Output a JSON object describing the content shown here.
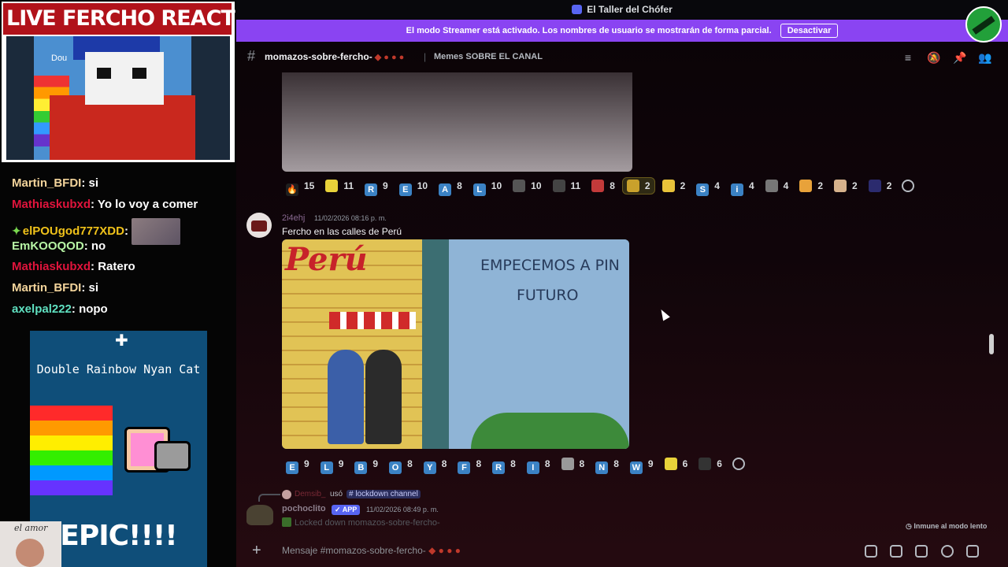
{
  "stream": {
    "title": "LIVE FERCHO REACTION",
    "cam_text": "Dou",
    "chat": [
      {
        "user": "Martin_BFDI",
        "user_color": "#f3d49b",
        "msg": ": si"
      },
      {
        "user": "Mathiaskubxd",
        "user_color": "#e0143c",
        "msg": ": Yo lo voy a comer"
      },
      {
        "user": "elPOUgod777XDD",
        "user_color": "#f0c21a",
        "msg": ":",
        "thumb": true,
        "diamond": true
      },
      {
        "user": "EmKOOQOD",
        "user_color": "#b7f5a5",
        "msg": ": no"
      },
      {
        "user": "Mathiaskubxd",
        "user_color": "#e0143c",
        "msg": ": Ratero"
      },
      {
        "user": "Martin_BFDI",
        "user_color": "#f3d49b",
        "msg": ": si"
      },
      {
        "user": "axelpal222",
        "user_color": "#5fe0c0",
        "msg": ": nopo"
      }
    ],
    "nyan_title": "Double Rainbow Nyan Cat",
    "nyan_epic": "EPIC!!!!",
    "corner_text": "el amor"
  },
  "discord": {
    "window_title": "El Taller del Chófer",
    "streamer_notice": "El modo Streamer está activado. Los nombres de usuario se mostrarán de forma parcial.",
    "streamer_button": "Desactivar",
    "channel_name": "momazos-sobre-fercho-",
    "channel_divider": "|",
    "channel_topic": "Memes SOBRE EL CANAL",
    "reactions_1": [
      {
        "label": "🔥",
        "count": "15",
        "color": "#1f1f1f"
      },
      {
        "label": "",
        "count": "11",
        "color": "#e8d23a"
      },
      {
        "label": "R",
        "count": "9",
        "color": "#3b82c4"
      },
      {
        "label": "E",
        "count": "10",
        "color": "#3b82c4"
      },
      {
        "label": "A",
        "count": "8",
        "color": "#3b82c4"
      },
      {
        "label": "L",
        "count": "10",
        "color": "#3b82c4"
      },
      {
        "label": "",
        "count": "10",
        "color": "#555"
      },
      {
        "label": "",
        "count": "11",
        "color": "#444"
      },
      {
        "label": "",
        "count": "8",
        "color": "#c23a3a"
      },
      {
        "label": "",
        "count": "2",
        "color": "#c9a12c",
        "on": true
      },
      {
        "label": "",
        "count": "2",
        "color": "#e8c23a"
      },
      {
        "label": "S",
        "count": "4",
        "color": "#3b82c4"
      },
      {
        "label": "i",
        "count": "4",
        "color": "#3b82c4"
      },
      {
        "label": "",
        "count": "4",
        "color": "#777"
      },
      {
        "label": "",
        "count": "2",
        "color": "#e8a23a"
      },
      {
        "label": "",
        "count": "2",
        "color": "#d6b28c"
      },
      {
        "label": "",
        "count": "2",
        "color": "#2b2b6e"
      }
    ],
    "msg1": {
      "user": "2i4ehj",
      "time": "11/02/2026 08:16 p. m.",
      "text": "Fercho en las calles de Perú",
      "mural_peru": "Perú",
      "mural_line1": "EMPECEMOS A PIN",
      "mural_line2": "FUTURO"
    },
    "reactions_2": [
      {
        "label": "E",
        "count": "9",
        "color": "#3b82c4"
      },
      {
        "label": "L",
        "count": "9",
        "color": "#3b82c4"
      },
      {
        "label": "B",
        "count": "9",
        "color": "#3b82c4"
      },
      {
        "label": "O",
        "count": "8",
        "color": "#3b82c4"
      },
      {
        "label": "Y",
        "count": "8",
        "color": "#3b82c4"
      },
      {
        "label": "F",
        "count": "8",
        "color": "#3b82c4"
      },
      {
        "label": "R",
        "count": "8",
        "color": "#3b82c4"
      },
      {
        "label": "I",
        "count": "8",
        "color": "#3b82c4"
      },
      {
        "label": "",
        "count": "8",
        "color": "#999"
      },
      {
        "label": "N",
        "count": "8",
        "color": "#3b82c4"
      },
      {
        "label": "W",
        "count": "9",
        "color": "#3b82c4"
      },
      {
        "label": "",
        "count": "6",
        "color": "#e8d23a"
      },
      {
        "label": "",
        "count": "6",
        "color": "#333"
      }
    ],
    "reply_user": "Demsib_",
    "reply_used": "usó",
    "reply_channel": "# lockdown channel",
    "msg2": {
      "user": "pochoclito",
      "app_badge": "✓ APP",
      "time": "11/02/2026 08:49 p. m.",
      "text": "Locked down momazos-sobre-fercho-"
    },
    "slowmode": "Inmune al modo lento",
    "composer_placeholder": "Mensaje #momazos-sobre-fercho-"
  }
}
